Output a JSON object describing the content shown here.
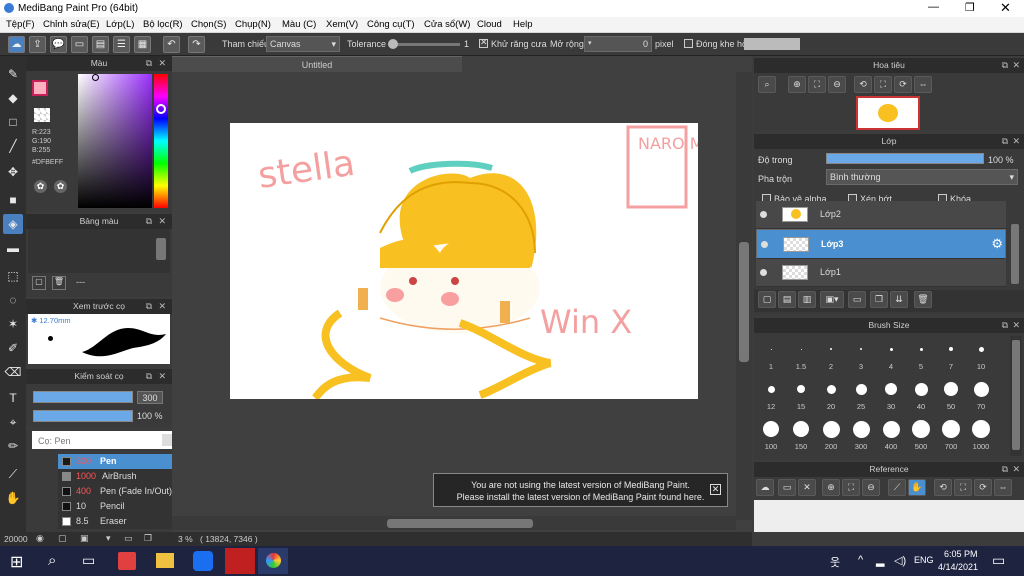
{
  "window": {
    "title": "MediBang Paint Pro (64bit)"
  },
  "menu": [
    "Tệp(F)",
    "Chỉnh sửa(E)",
    "Lớp(L)",
    "Bộ lọc(R)",
    "Chọn(S)",
    "Chụp(N)",
    "Màu (C)",
    "Xem(V)",
    "Công cụ(T)",
    "Cửa sổ(W)",
    "Cloud",
    "Help"
  ],
  "toolbar": {
    "ref_label": "Tham chiếu",
    "ref_value": "Canvas",
    "tolerance_label": "Tolerance",
    "tolerance_value": "1",
    "antialias_label": "Khử răng cưa",
    "expand_label": "Mở rộng",
    "expand_value": "0",
    "expand_unit": "pixel",
    "close_gap_label": "Đóng khe hở"
  },
  "color_panel": {
    "title": "Màu",
    "r": "R:223",
    "g": "G:190",
    "b": "B:255",
    "hex": "#DFBEFF",
    "fg": "#DFBEFF"
  },
  "palette_panel": {
    "title": "Bảng màu",
    "dash": "---"
  },
  "brush_preview": {
    "title": "Xem trước cọ",
    "size": "12.70mm"
  },
  "brush_control": {
    "title": "Kiểm soát cọ",
    "size": "300",
    "opacity": "100 %"
  },
  "brush_list": {
    "header": "Cọ: Pen",
    "items": [
      {
        "size": "300",
        "name": "Pen",
        "color": "#1a1a1a"
      },
      {
        "size": "1000",
        "name": "AirBrush",
        "color": "#888888"
      },
      {
        "size": "400",
        "name": "Pen (Fade In/Out)",
        "color": "#1a1a1a"
      },
      {
        "size": "10",
        "name": "Pencil",
        "color": "#1a1a1a"
      },
      {
        "size": "8.5",
        "name": "Eraser",
        "color": "#ffffff"
      }
    ]
  },
  "canvas": {
    "tab": "Untitled",
    "text_stella": "stella",
    "text_winx": "Win X",
    "text_nar": "NARO ME"
  },
  "notice": {
    "line1": "You are not using the latest version of MediBang Paint.",
    "line2": "Please install the latest version of MediBang Paint found here."
  },
  "status": {
    "size": "20000",
    "zoom": "3 %",
    "coords": "( 13824, 7346 )"
  },
  "navigator": {
    "title": "Hoa tiêu"
  },
  "layers_panel": {
    "title": "Lớp",
    "opacity_label": "Độ trong",
    "opacity_value": "100 %",
    "blend_label": "Pha trộn",
    "blend_value": "Bình thường",
    "protect_alpha": "Bảo vệ alpha",
    "clip": "Xén bớt",
    "lock": "Khóa",
    "layers": [
      {
        "name": "Lớp2",
        "selected": false
      },
      {
        "name": "Lớp3",
        "selected": true
      },
      {
        "name": "Lớp1",
        "selected": false
      }
    ]
  },
  "brush_size_panel": {
    "title": "Brush Size",
    "sizes": [
      "1",
      "1.5",
      "2",
      "3",
      "4",
      "5",
      "7",
      "10",
      "12",
      "15",
      "20",
      "25",
      "30",
      "40",
      "50",
      "70",
      "100",
      "150",
      "200",
      "300",
      "400",
      "500",
      "700",
      "1000"
    ]
  },
  "reference_panel": {
    "title": "Reference"
  },
  "taskbar": {
    "time": "6:05 PM",
    "date": "4/14/2021",
    "lang": "ENG"
  }
}
